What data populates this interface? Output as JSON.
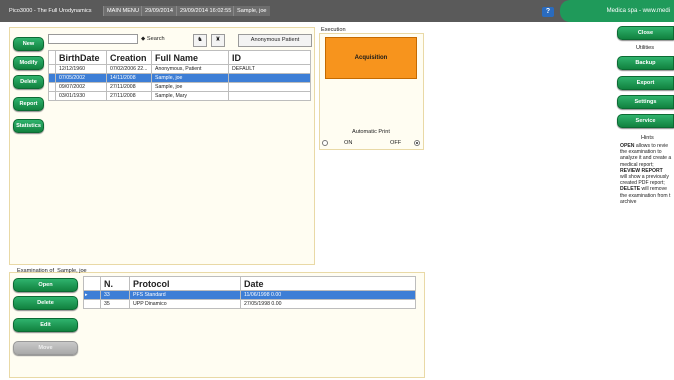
{
  "titlebar": {
    "app": "Pico3000 - The Full Urodynamics",
    "menu": "MAIN MENU",
    "date": "29/09/2014",
    "datetime": "29/09/2014 16:02:55",
    "patient": "Sample, joe",
    "help": "?",
    "brand": "Medica spa - www.medi"
  },
  "left_buttons": {
    "new": "New",
    "modify": "Modify",
    "delete": "Delete",
    "report": "Report",
    "statistics": "Statistics"
  },
  "search": {
    "value": "",
    "placeholder": "",
    "label": "Search",
    "anon_button": "Anonymous Patient"
  },
  "patients": {
    "columns": [
      "BirthDate",
      "Creation",
      "Full Name",
      "ID"
    ],
    "rows": [
      [
        "12/12/1960",
        "07/02/2006 22...",
        "Anonymous, Patient",
        "DEFAULT"
      ],
      [
        "07/05/2002",
        "14/11/2008",
        "Sample, joe",
        ""
      ],
      [
        "09/07/2002",
        "27/11/2008",
        "Sample, joe",
        ""
      ],
      [
        "03/01/1930",
        "27/11/2008",
        "Sample, Mary",
        ""
      ]
    ]
  },
  "execution": {
    "title": "Execution",
    "acq": "Acquisition",
    "auto_print": "Automatic Print",
    "on": "ON",
    "off": "OFF"
  },
  "exam": {
    "title": "Examination of",
    "patient": "Sample, joe",
    "buttons": {
      "open": "Open",
      "delete": "Delete",
      "edit": "Edit",
      "move": "Move"
    },
    "columns": [
      "N.",
      "Protocol",
      "Date"
    ],
    "rows": [
      [
        "33",
        "PFS Standard",
        "11/06/1998 0.00"
      ],
      [
        "35",
        "UPP Dinamico",
        "27/05/1998 0.00"
      ]
    ],
    "indicator": "▸"
  },
  "right": {
    "close": "Close",
    "utilities": "Utilities",
    "backup": "Backup",
    "export": "Export",
    "settings": "Settings",
    "service": "Service",
    "hints_title": "Hints",
    "hints": [
      {
        "bold": "OPEN",
        "text": " allows to revie"
      },
      {
        "bold": "",
        "text": "the examination to"
      },
      {
        "bold": "",
        "text": "analyze it and create a"
      },
      {
        "bold": "",
        "text": "medical report;"
      },
      {
        "bold": "REVIEW REPORT",
        "text": ""
      },
      {
        "bold": "",
        "text": "will show a previously"
      },
      {
        "bold": "",
        "text": "created PDF report;"
      },
      {
        "bold": "DELETE",
        "text": " will remove"
      },
      {
        "bold": "",
        "text": "the examination from t"
      },
      {
        "bold": "",
        "text": "archive"
      }
    ]
  },
  "colors": {
    "accent": "#1f9a5a",
    "acquisition": "#f7941d",
    "selection": "#3d7ed6",
    "panel": "#fffdf2"
  }
}
